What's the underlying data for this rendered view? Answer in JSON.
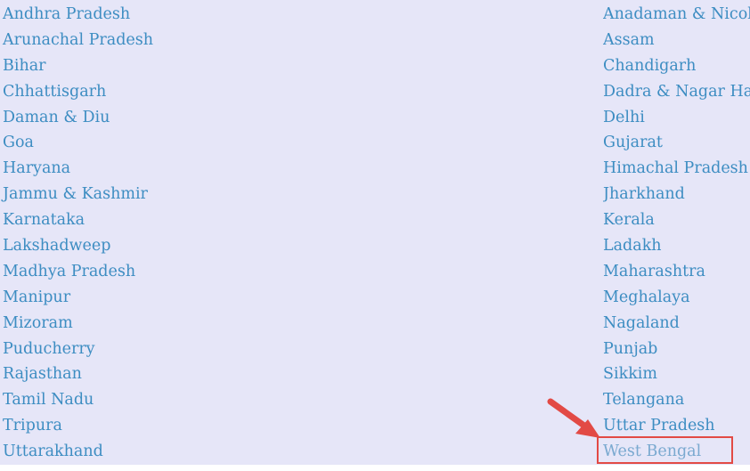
{
  "left_column": [
    "Andhra Pradesh",
    "Arunachal Pradesh",
    "Bihar",
    "Chhattisgarh",
    "Daman & Diu",
    "Goa",
    "Haryana",
    "Jammu & Kashmir",
    "Karnataka",
    "Lakshadweep",
    "Madhya Pradesh",
    "Manipur",
    "Mizoram",
    "Puducherry",
    "Rajasthan",
    "Tamil Nadu",
    "Tripura",
    "Uttarakhand"
  ],
  "right_column": [
    "Anadaman & Nicobar",
    "Assam",
    "Chandigarh",
    "Dadra & Nagar Haveli",
    "Delhi",
    "Gujarat",
    "Himachal Pradesh",
    "Jharkhand",
    "Kerala",
    "Ladakh",
    "Maharashtra",
    "Meghalaya",
    "Nagaland",
    "Punjab",
    "Sikkim",
    "Telangana",
    "Uttar Pradesh",
    "West Bengal"
  ],
  "highlighted_item": "West Bengal",
  "colors": {
    "link": "#3d8dc2",
    "highlight": "#e24a45",
    "background": "#e6e6f8"
  }
}
